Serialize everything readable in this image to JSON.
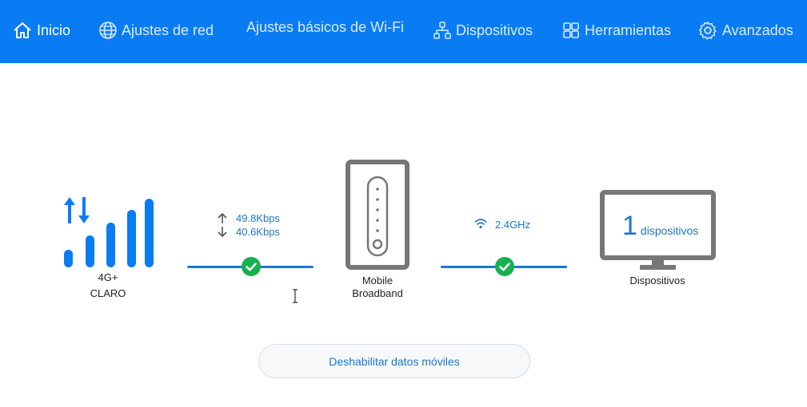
{
  "nav": {
    "inicio": "Inicio",
    "ajustes_red": "Ajustes de red",
    "wifi_basico": "Ajustes básicos de Wi-Fi",
    "dispositivos": "Dispositivos",
    "herramientas": "Herramientas",
    "avanzados": "Avanzados"
  },
  "network": {
    "type": "4G+",
    "carrier": "CLARO",
    "upload_rate": "49.8Kbps",
    "download_rate": "40.6Kbps"
  },
  "router": {
    "label_line1": "Mobile",
    "label_line2": "Broadband"
  },
  "wifi": {
    "band": "2.4GHz"
  },
  "devices": {
    "count": "1",
    "count_unit": "dispositivos",
    "label": "Dispositivos"
  },
  "actions": {
    "disable_data": "Deshabilitar datos móviles"
  },
  "colors": {
    "brand": "#0a7cf3",
    "signal": "#0a7cf3",
    "status_ok": "#17b04f",
    "link": "#1d76c9"
  }
}
